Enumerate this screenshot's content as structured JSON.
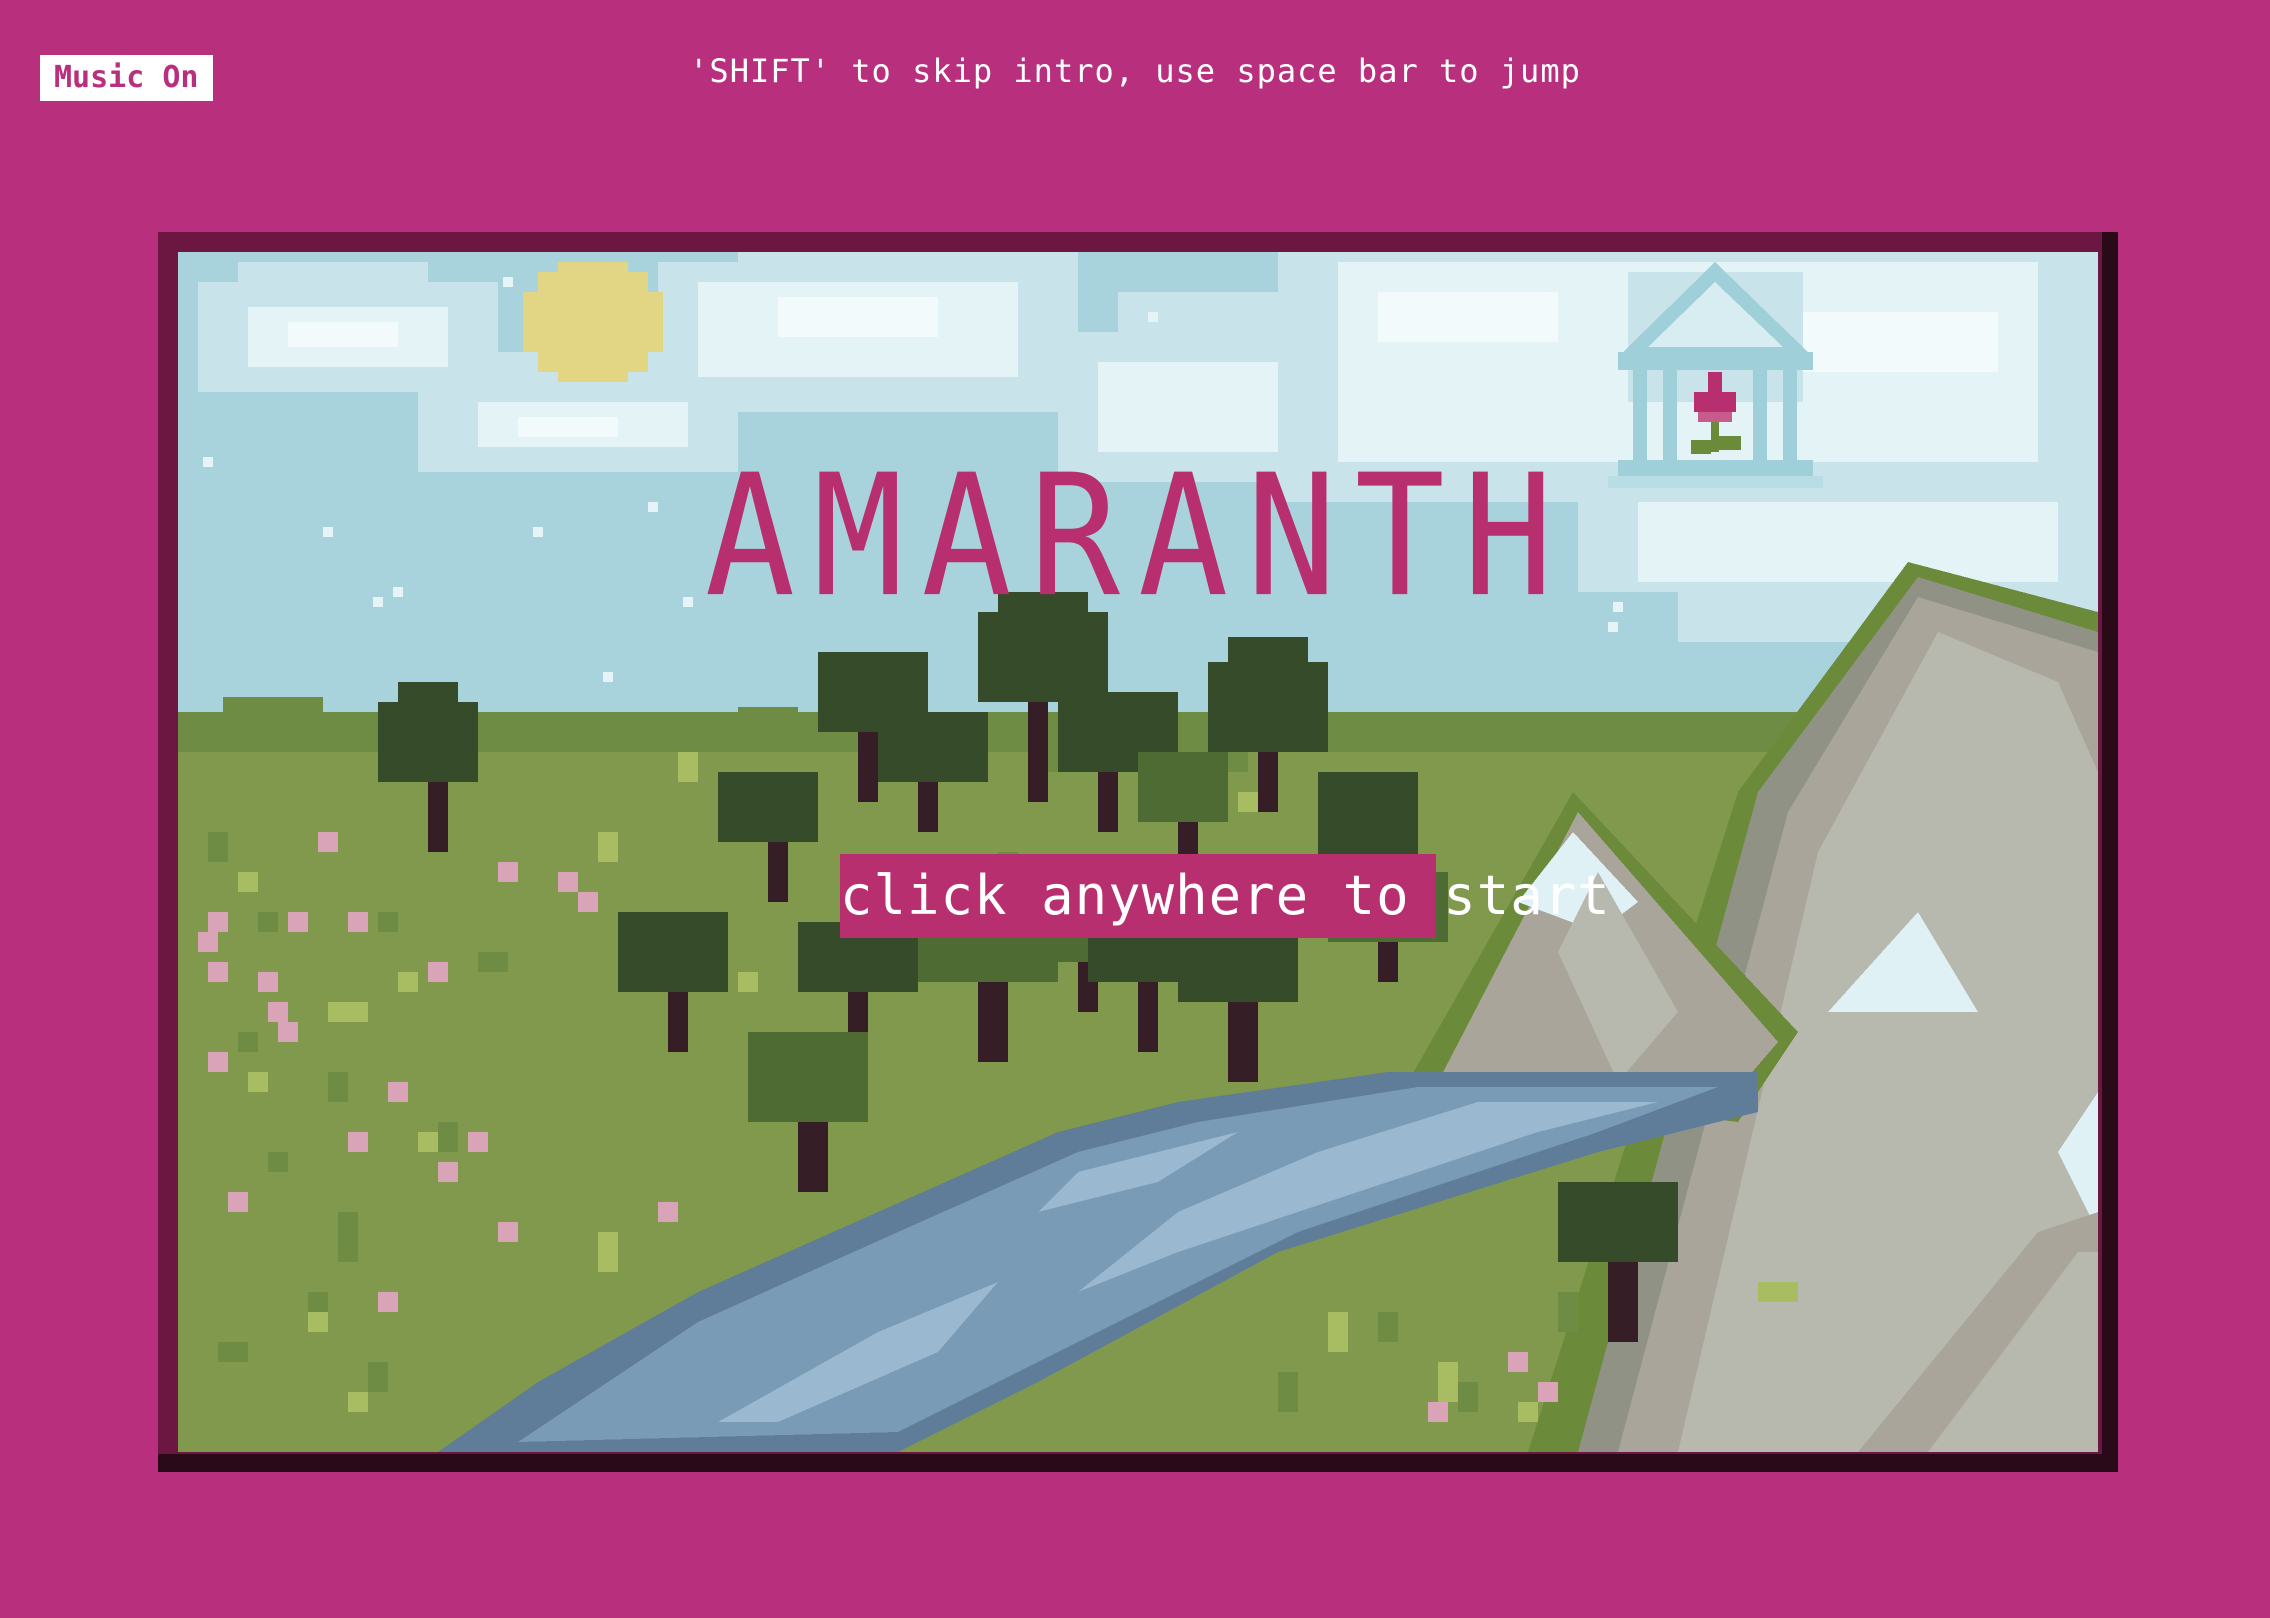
{
  "music_toggle": {
    "label": "Music On"
  },
  "instructions": "'SHIFT' to skip intro, use space bar to jump",
  "game": {
    "title": "AMARANTH",
    "start_prompt": "click anywhere to start"
  },
  "colors": {
    "page_background": "#b82f7d",
    "frame": "#6b1741",
    "sky": "#a9d3dc",
    "title": "#b82f6f",
    "grass": "#7f9a4c",
    "river": "#7a9bb6",
    "mountain": "#aaa59b"
  }
}
